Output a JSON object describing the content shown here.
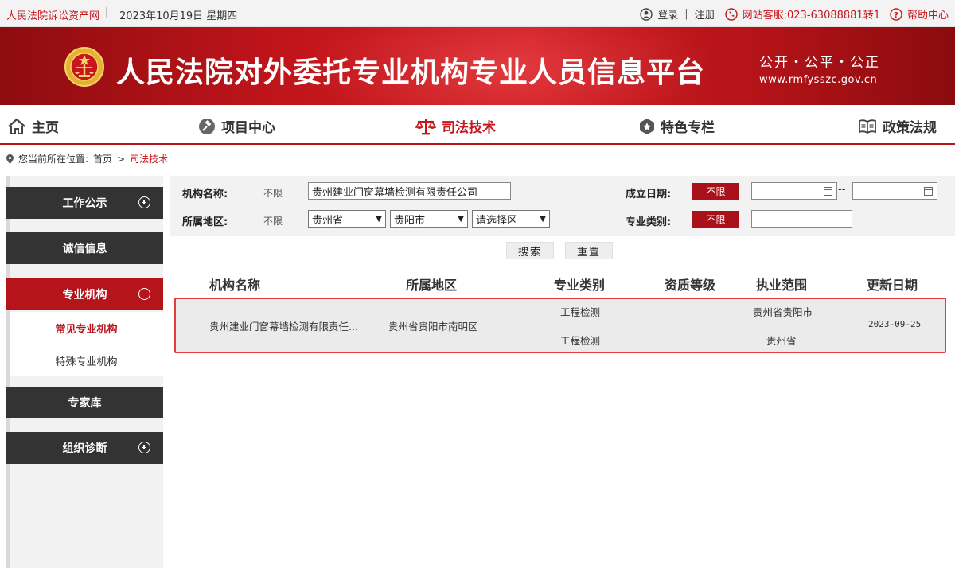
{
  "topbar": {
    "site_name": "人民法院诉讼资产网",
    "separator": "|",
    "date": "2023年10月19日  星期四",
    "login": "登录",
    "register": "注册",
    "hotline": "网站客服:023-63088881转1",
    "help": "帮助中心",
    "icons": [
      "user-icon",
      "phone-icon",
      "help-icon"
    ]
  },
  "banner": {
    "title": "人民法院对外委托专业机构专业人员信息平台",
    "slogan": "公开・公平・公正",
    "url": "www.rmfysszc.gov.cn"
  },
  "nav": {
    "items": [
      {
        "label": "主页",
        "icon": "home-icon",
        "active": false
      },
      {
        "label": "项目中心",
        "icon": "gavel-icon",
        "active": false
      },
      {
        "label": "司法技术",
        "icon": "scales-icon",
        "active": true
      },
      {
        "label": "特色专栏",
        "icon": "badge-icon",
        "active": false
      },
      {
        "label": "政策法规",
        "icon": "book-icon",
        "active": false
      }
    ]
  },
  "breadcrumb": {
    "prefix": "您当前所在位置:",
    "home": "首页",
    "arrow": ">",
    "current": "司法技术"
  },
  "sidebar": {
    "items": [
      {
        "label": "工作公示",
        "toggle": "plus"
      },
      {
        "label": "诚信信息",
        "toggle": ""
      },
      {
        "label": "专业机构",
        "toggle": "minus",
        "active": true
      },
      {
        "label": "专家库",
        "toggle": ""
      },
      {
        "label": "组织诊断",
        "toggle": "plus"
      }
    ],
    "subitems": [
      {
        "label": "常见专业机构",
        "active": true
      },
      {
        "label": "特殊专业机构",
        "active": false
      }
    ]
  },
  "filter": {
    "org_name_label": "机构名称:",
    "org_name_none": "不限",
    "org_name_value": "贵州建业门窗幕墙检测有限责任公司",
    "found_date_label": "成立日期:",
    "found_date_btn": "不限",
    "date_sep": "--",
    "region_label": "所属地区:",
    "region_none": "不限",
    "province": "贵州省",
    "city": "贵阳市",
    "district_placeholder": "请选择区",
    "category_label": "专业类别:",
    "category_btn": "不限",
    "category_value": "",
    "search_btn": "搜索",
    "reset_btn": "重置"
  },
  "table": {
    "headers": [
      "机构名称",
      "所属地区",
      "专业类别",
      "资质等级",
      "执业范围",
      "更新日期"
    ],
    "rows": [
      {
        "name": "贵州建业门窗幕墙检测有限责任...",
        "region": "贵州省贵阳市南明区",
        "category_1": "工程检测",
        "category_2": "工程检测",
        "level": "",
        "scope_1": "贵州省贵阳市",
        "scope_2": "贵州省",
        "updated": "2023-09-25"
      }
    ]
  },
  "colors": {
    "brand_red": "#c8161d",
    "dark_red": "#b5141a",
    "sidebar_dark": "#333333",
    "row_highlight_border": "#e53b3b"
  }
}
